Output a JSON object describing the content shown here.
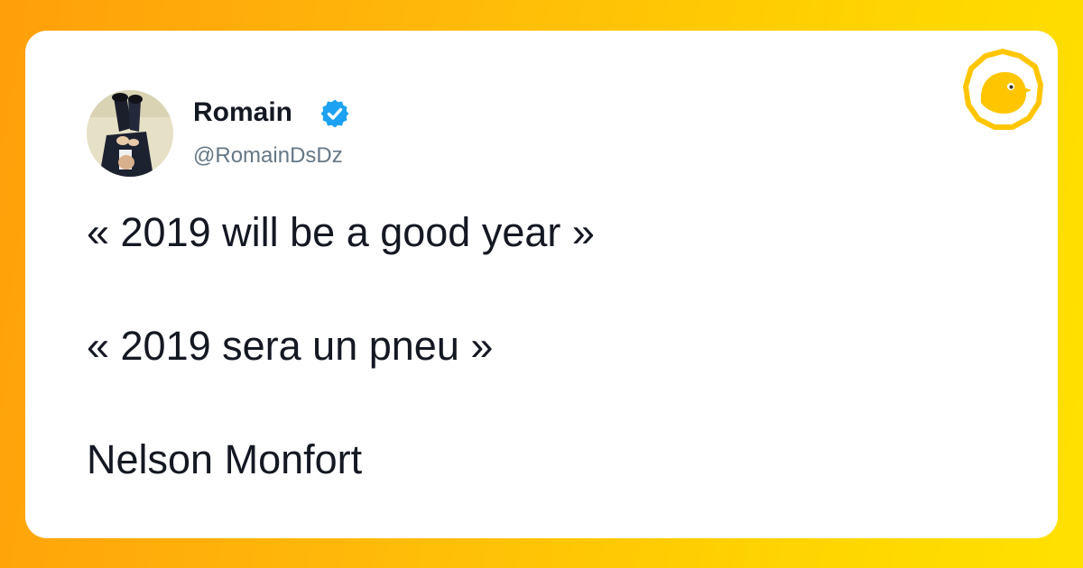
{
  "tweet": {
    "author": {
      "name": "Romain",
      "handle": "@RomainDsDz",
      "verified": true,
      "avatar_icon": "user-avatar"
    },
    "lines": [
      "« 2019 will be a good year »",
      "« 2019 sera un pneu »",
      "Nelson Monfort"
    ]
  },
  "brand": {
    "logo_icon": "bird-hexagon-logo",
    "color": "#ffc600"
  },
  "colors": {
    "background_gradient_start": "#ff9f0a",
    "background_gradient_end": "#ffe100",
    "card": "#ffffff",
    "text": "#141823",
    "handle": "#657786",
    "verified": "#1da1f2"
  }
}
